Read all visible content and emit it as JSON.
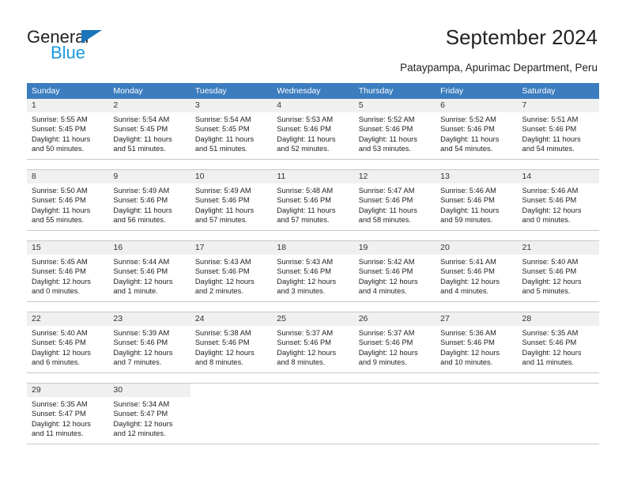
{
  "brand": {
    "name_top": "General",
    "name_bottom": "Blue",
    "color_dark": "#231f20",
    "color_blue": "#1b9ae0",
    "triangle_color": "#1b75bb"
  },
  "header": {
    "title": "September 2024",
    "subtitle": "Pataypampa, Apurimac Department, Peru"
  },
  "theme": {
    "header_row_bg": "#3b7dbf",
    "header_row_text": "#ffffff",
    "daynum_band_bg": "#f0f0f0",
    "cell_border": "#c8c8c8"
  },
  "weekdays": [
    "Sunday",
    "Monday",
    "Tuesday",
    "Wednesday",
    "Thursday",
    "Friday",
    "Saturday"
  ],
  "weeks": [
    [
      {
        "day": "1",
        "sunrise": "Sunrise: 5:55 AM",
        "sunset": "Sunset: 5:45 PM",
        "daylight1": "Daylight: 11 hours",
        "daylight2": "and 50 minutes."
      },
      {
        "day": "2",
        "sunrise": "Sunrise: 5:54 AM",
        "sunset": "Sunset: 5:45 PM",
        "daylight1": "Daylight: 11 hours",
        "daylight2": "and 51 minutes."
      },
      {
        "day": "3",
        "sunrise": "Sunrise: 5:54 AM",
        "sunset": "Sunset: 5:45 PM",
        "daylight1": "Daylight: 11 hours",
        "daylight2": "and 51 minutes."
      },
      {
        "day": "4",
        "sunrise": "Sunrise: 5:53 AM",
        "sunset": "Sunset: 5:46 PM",
        "daylight1": "Daylight: 11 hours",
        "daylight2": "and 52 minutes."
      },
      {
        "day": "5",
        "sunrise": "Sunrise: 5:52 AM",
        "sunset": "Sunset: 5:46 PM",
        "daylight1": "Daylight: 11 hours",
        "daylight2": "and 53 minutes."
      },
      {
        "day": "6",
        "sunrise": "Sunrise: 5:52 AM",
        "sunset": "Sunset: 5:46 PM",
        "daylight1": "Daylight: 11 hours",
        "daylight2": "and 54 minutes."
      },
      {
        "day": "7",
        "sunrise": "Sunrise: 5:51 AM",
        "sunset": "Sunset: 5:46 PM",
        "daylight1": "Daylight: 11 hours",
        "daylight2": "and 54 minutes."
      }
    ],
    [
      {
        "day": "8",
        "sunrise": "Sunrise: 5:50 AM",
        "sunset": "Sunset: 5:46 PM",
        "daylight1": "Daylight: 11 hours",
        "daylight2": "and 55 minutes."
      },
      {
        "day": "9",
        "sunrise": "Sunrise: 5:49 AM",
        "sunset": "Sunset: 5:46 PM",
        "daylight1": "Daylight: 11 hours",
        "daylight2": "and 56 minutes."
      },
      {
        "day": "10",
        "sunrise": "Sunrise: 5:49 AM",
        "sunset": "Sunset: 5:46 PM",
        "daylight1": "Daylight: 11 hours",
        "daylight2": "and 57 minutes."
      },
      {
        "day": "11",
        "sunrise": "Sunrise: 5:48 AM",
        "sunset": "Sunset: 5:46 PM",
        "daylight1": "Daylight: 11 hours",
        "daylight2": "and 57 minutes."
      },
      {
        "day": "12",
        "sunrise": "Sunrise: 5:47 AM",
        "sunset": "Sunset: 5:46 PM",
        "daylight1": "Daylight: 11 hours",
        "daylight2": "and 58 minutes."
      },
      {
        "day": "13",
        "sunrise": "Sunrise: 5:46 AM",
        "sunset": "Sunset: 5:46 PM",
        "daylight1": "Daylight: 11 hours",
        "daylight2": "and 59 minutes."
      },
      {
        "day": "14",
        "sunrise": "Sunrise: 5:46 AM",
        "sunset": "Sunset: 5:46 PM",
        "daylight1": "Daylight: 12 hours",
        "daylight2": "and 0 minutes."
      }
    ],
    [
      {
        "day": "15",
        "sunrise": "Sunrise: 5:45 AM",
        "sunset": "Sunset: 5:46 PM",
        "daylight1": "Daylight: 12 hours",
        "daylight2": "and 0 minutes."
      },
      {
        "day": "16",
        "sunrise": "Sunrise: 5:44 AM",
        "sunset": "Sunset: 5:46 PM",
        "daylight1": "Daylight: 12 hours",
        "daylight2": "and 1 minute."
      },
      {
        "day": "17",
        "sunrise": "Sunrise: 5:43 AM",
        "sunset": "Sunset: 5:46 PM",
        "daylight1": "Daylight: 12 hours",
        "daylight2": "and 2 minutes."
      },
      {
        "day": "18",
        "sunrise": "Sunrise: 5:43 AM",
        "sunset": "Sunset: 5:46 PM",
        "daylight1": "Daylight: 12 hours",
        "daylight2": "and 3 minutes."
      },
      {
        "day": "19",
        "sunrise": "Sunrise: 5:42 AM",
        "sunset": "Sunset: 5:46 PM",
        "daylight1": "Daylight: 12 hours",
        "daylight2": "and 4 minutes."
      },
      {
        "day": "20",
        "sunrise": "Sunrise: 5:41 AM",
        "sunset": "Sunset: 5:46 PM",
        "daylight1": "Daylight: 12 hours",
        "daylight2": "and 4 minutes."
      },
      {
        "day": "21",
        "sunrise": "Sunrise: 5:40 AM",
        "sunset": "Sunset: 5:46 PM",
        "daylight1": "Daylight: 12 hours",
        "daylight2": "and 5 minutes."
      }
    ],
    [
      {
        "day": "22",
        "sunrise": "Sunrise: 5:40 AM",
        "sunset": "Sunset: 5:46 PM",
        "daylight1": "Daylight: 12 hours",
        "daylight2": "and 6 minutes."
      },
      {
        "day": "23",
        "sunrise": "Sunrise: 5:39 AM",
        "sunset": "Sunset: 5:46 PM",
        "daylight1": "Daylight: 12 hours",
        "daylight2": "and 7 minutes."
      },
      {
        "day": "24",
        "sunrise": "Sunrise: 5:38 AM",
        "sunset": "Sunset: 5:46 PM",
        "daylight1": "Daylight: 12 hours",
        "daylight2": "and 8 minutes."
      },
      {
        "day": "25",
        "sunrise": "Sunrise: 5:37 AM",
        "sunset": "Sunset: 5:46 PM",
        "daylight1": "Daylight: 12 hours",
        "daylight2": "and 8 minutes."
      },
      {
        "day": "26",
        "sunrise": "Sunrise: 5:37 AM",
        "sunset": "Sunset: 5:46 PM",
        "daylight1": "Daylight: 12 hours",
        "daylight2": "and 9 minutes."
      },
      {
        "day": "27",
        "sunrise": "Sunrise: 5:36 AM",
        "sunset": "Sunset: 5:46 PM",
        "daylight1": "Daylight: 12 hours",
        "daylight2": "and 10 minutes."
      },
      {
        "day": "28",
        "sunrise": "Sunrise: 5:35 AM",
        "sunset": "Sunset: 5:46 PM",
        "daylight1": "Daylight: 12 hours",
        "daylight2": "and 11 minutes."
      }
    ],
    [
      {
        "day": "29",
        "sunrise": "Sunrise: 5:35 AM",
        "sunset": "Sunset: 5:47 PM",
        "daylight1": "Daylight: 12 hours",
        "daylight2": "and 11 minutes."
      },
      {
        "day": "30",
        "sunrise": "Sunrise: 5:34 AM",
        "sunset": "Sunset: 5:47 PM",
        "daylight1": "Daylight: 12 hours",
        "daylight2": "and 12 minutes."
      },
      {
        "day": "",
        "sunrise": "",
        "sunset": "",
        "daylight1": "",
        "daylight2": ""
      },
      {
        "day": "",
        "sunrise": "",
        "sunset": "",
        "daylight1": "",
        "daylight2": ""
      },
      {
        "day": "",
        "sunrise": "",
        "sunset": "",
        "daylight1": "",
        "daylight2": ""
      },
      {
        "day": "",
        "sunrise": "",
        "sunset": "",
        "daylight1": "",
        "daylight2": ""
      },
      {
        "day": "",
        "sunrise": "",
        "sunset": "",
        "daylight1": "",
        "daylight2": ""
      }
    ]
  ]
}
